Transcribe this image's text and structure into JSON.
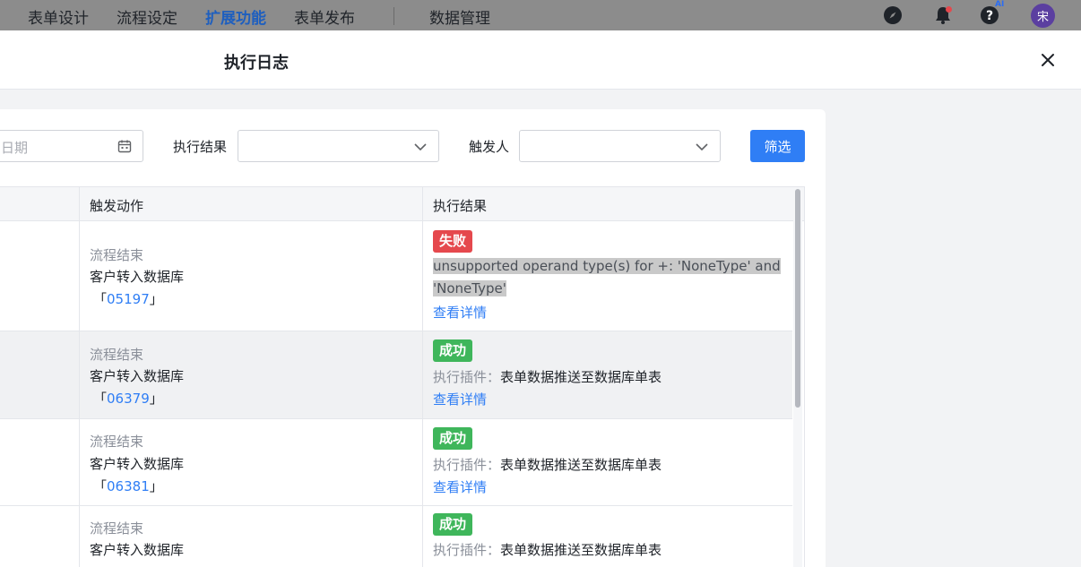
{
  "topnav": {
    "items": [
      {
        "label": "表单设计",
        "active": false
      },
      {
        "label": "流程设定",
        "active": false
      },
      {
        "label": "扩展功能",
        "active": true
      },
      {
        "label": "表单发布",
        "active": false
      },
      {
        "label": "数据管理",
        "active": false
      }
    ],
    "ai_badge": "AI",
    "avatar_text": "宋"
  },
  "drawer": {
    "title": "执行日志"
  },
  "filters": {
    "date_placeholder": "日期",
    "result_label": "执行结果",
    "trigger_label": "触发人",
    "filter_button": "筛选"
  },
  "table": {
    "headers": {
      "action": "触发动作",
      "result": "执行结果"
    },
    "rows": [
      {
        "action_type": "流程结束",
        "action_name": "客户转入数据库",
        "bracket_open": "「",
        "record_id": "05197",
        "bracket_close": "」",
        "status": "失败",
        "error_line1": "unsupported operand type(s) for +: 'NoneType' and",
        "error_line2": "'NoneType'",
        "detail_link": "查看详情"
      },
      {
        "action_type": "流程结束",
        "action_name": "客户转入数据库",
        "bracket_open": "「",
        "record_id": "06379",
        "bracket_close": "」",
        "status": "成功",
        "plugin_label": "执行插件：",
        "plugin_name": "表单数据推送至数据库单表",
        "detail_link": "查看详情"
      },
      {
        "action_type": "流程结束",
        "action_name": "客户转入数据库",
        "bracket_open": "「",
        "record_id": "06381",
        "bracket_close": "」",
        "status": "成功",
        "plugin_label": "执行插件：",
        "plugin_name": "表单数据推送至数据库单表",
        "detail_link": "查看详情"
      },
      {
        "action_type": "流程结束",
        "action_name": "客户转入数据库",
        "status": "成功",
        "plugin_label": "执行插件：",
        "plugin_name": "表单数据推送至数据库单表"
      }
    ]
  },
  "colors": {
    "accent": "#2f7ef5",
    "fail": "#e5484d",
    "success": "#3fb65b"
  }
}
